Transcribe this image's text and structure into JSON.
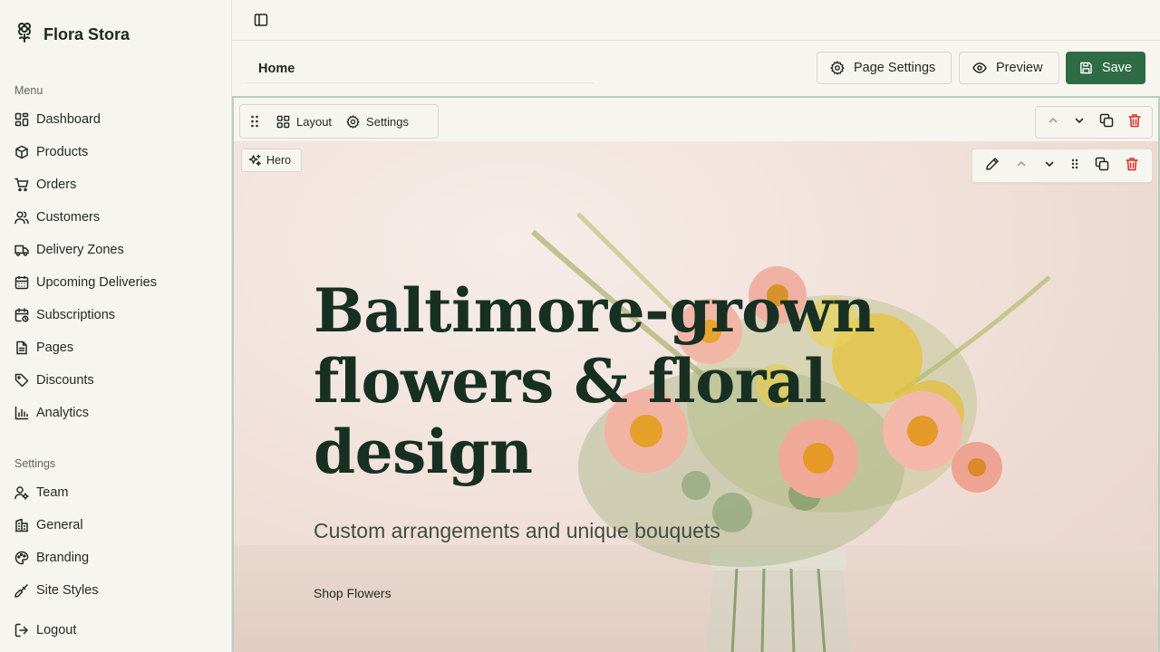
{
  "brand": {
    "name": "Flora Stora",
    "icon": "flower-icon"
  },
  "sidebar": {
    "menu_label": "Menu",
    "menu": [
      {
        "label": "Dashboard",
        "icon": "layout-grid-icon"
      },
      {
        "label": "Products",
        "icon": "package-icon"
      },
      {
        "label": "Orders",
        "icon": "cart-icon"
      },
      {
        "label": "Customers",
        "icon": "users-icon"
      },
      {
        "label": "Delivery Zones",
        "icon": "truck-icon"
      },
      {
        "label": "Upcoming Deliveries",
        "icon": "calendar-icon"
      },
      {
        "label": "Subscriptions",
        "icon": "calendar-refresh-icon"
      },
      {
        "label": "Pages",
        "icon": "document-icon"
      },
      {
        "label": "Discounts",
        "icon": "tag-icon"
      },
      {
        "label": "Analytics",
        "icon": "bar-chart-icon"
      }
    ],
    "settings_label": "Settings",
    "settings": [
      {
        "label": "Team",
        "icon": "user-cog-icon"
      },
      {
        "label": "General",
        "icon": "building-icon"
      },
      {
        "label": "Branding",
        "icon": "palette-icon"
      },
      {
        "label": "Site Styles",
        "icon": "brush-icon"
      }
    ],
    "logout": {
      "label": "Logout",
      "icon": "logout-icon"
    }
  },
  "toolbar": {
    "page_name": "Home",
    "page_settings_label": "Page Settings",
    "preview_label": "Preview",
    "save_label": "Save"
  },
  "section_toolbar": {
    "layout_label": "Layout",
    "settings_label": "Settings"
  },
  "hero": {
    "tag_label": "Hero",
    "title_lines": [
      "Baltimore-grown",
      "flowers & floral",
      "design"
    ],
    "subtitle": "Custom arrangements and unique bouquets",
    "cta_label": "Shop Flowers"
  },
  "colors": {
    "accent": "#2f6b45",
    "danger": "#d92d20",
    "background": "#f7f5f0",
    "hero_title": "#173023"
  }
}
